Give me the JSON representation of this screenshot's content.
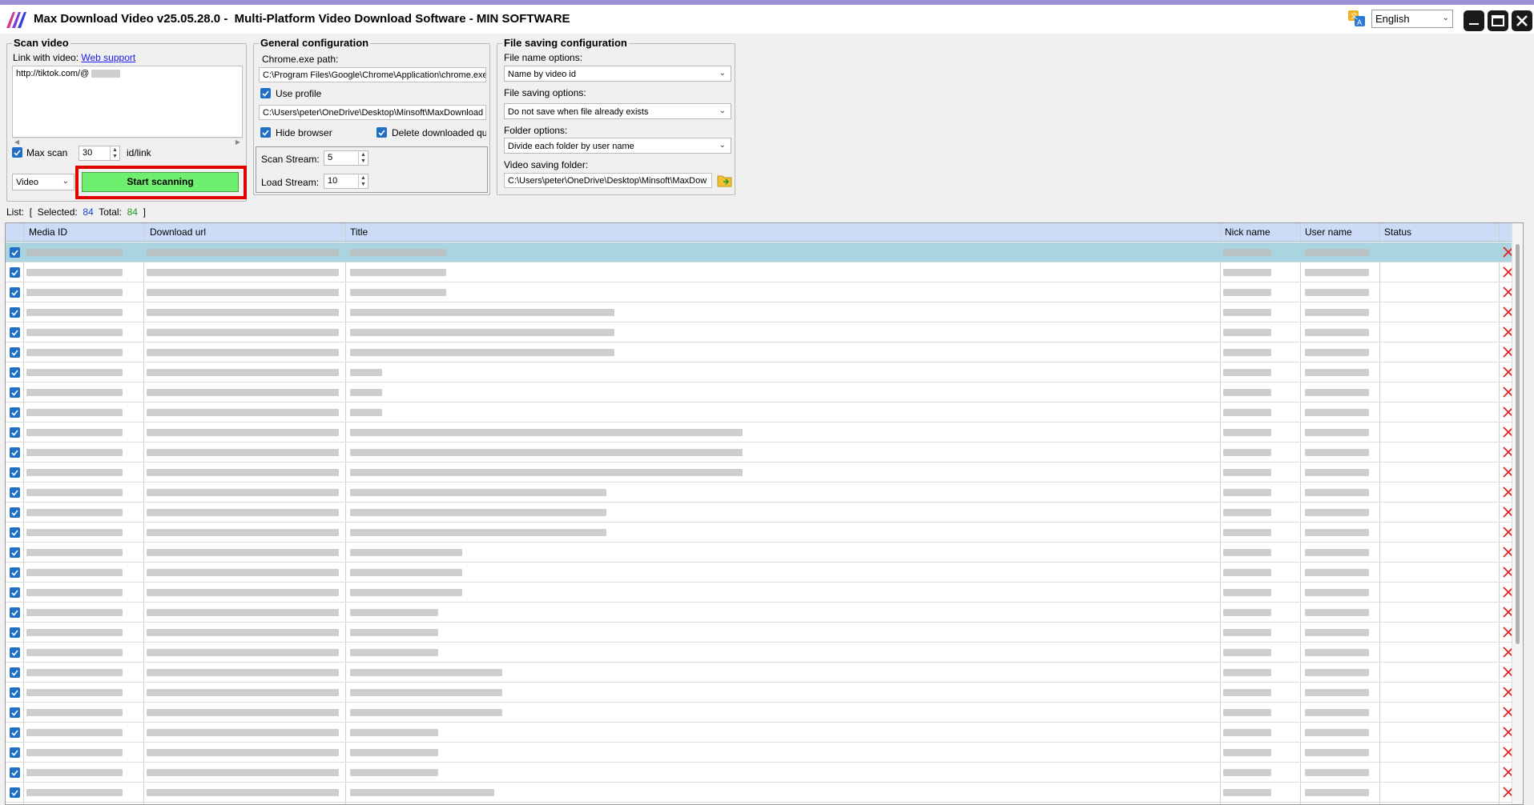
{
  "window": {
    "title": "Max Download Video v25.05.28.0 -  Multi-Platform Video Download Software - MIN SOFTWARE",
    "language": "English"
  },
  "scan": {
    "legend": "Scan video",
    "link_label": "Link with video:",
    "web_support": "Web support",
    "links_text": "http://tiktok.com/@",
    "max_scan_label": "Max scan",
    "max_scan_value": "30",
    "max_scan_unit": "id/link",
    "type_value": "Video",
    "start_button": "Start scanning"
  },
  "general": {
    "legend": "General configuration",
    "chrome_label": "Chrome.exe path:",
    "chrome_path": "C:\\Program Files\\Google\\Chrome\\Application\\chrome.exe",
    "use_profile": "Use profile",
    "profile_path": "C:\\Users\\peter\\OneDrive\\Desktop\\Minsoft\\MaxDownload",
    "hide_browser": "Hide browser",
    "delete_downloaded": "Delete downloaded que",
    "scan_stream_label": "Scan Stream:",
    "scan_stream_value": "5",
    "load_stream_label": "Load Stream:",
    "load_stream_value": "10"
  },
  "filesave": {
    "legend": "File saving configuration",
    "name_label": "File name options:",
    "name_value": "Name by video id",
    "save_label": "File saving options:",
    "save_value": "Do not save when file already exists",
    "folder_label": "Folder options:",
    "folder_value": "Divide each folder by user name",
    "video_folder_label": "Video saving folder:",
    "video_folder_value": "C:\\Users\\peter\\OneDrive\\Desktop\\Minsoft\\MaxDow"
  },
  "list": {
    "label": "List:",
    "selected_label": "Selected:",
    "selected_value": "84",
    "total_label": "Total:",
    "total_value": "84",
    "bracket_open": "[",
    "bracket_close": "]",
    "visible_rows": 28,
    "columns": [
      "Media ID",
      "Download url",
      "Title",
      "Nick name",
      "User name",
      "Status"
    ]
  },
  "colors": {
    "accent": "#1f6fc5",
    "start_button": "#6ef06e",
    "highlight_border": "#e00000",
    "delete": "#e02020",
    "header": "#ccdcf6",
    "selected_row": "#aad4e0"
  }
}
